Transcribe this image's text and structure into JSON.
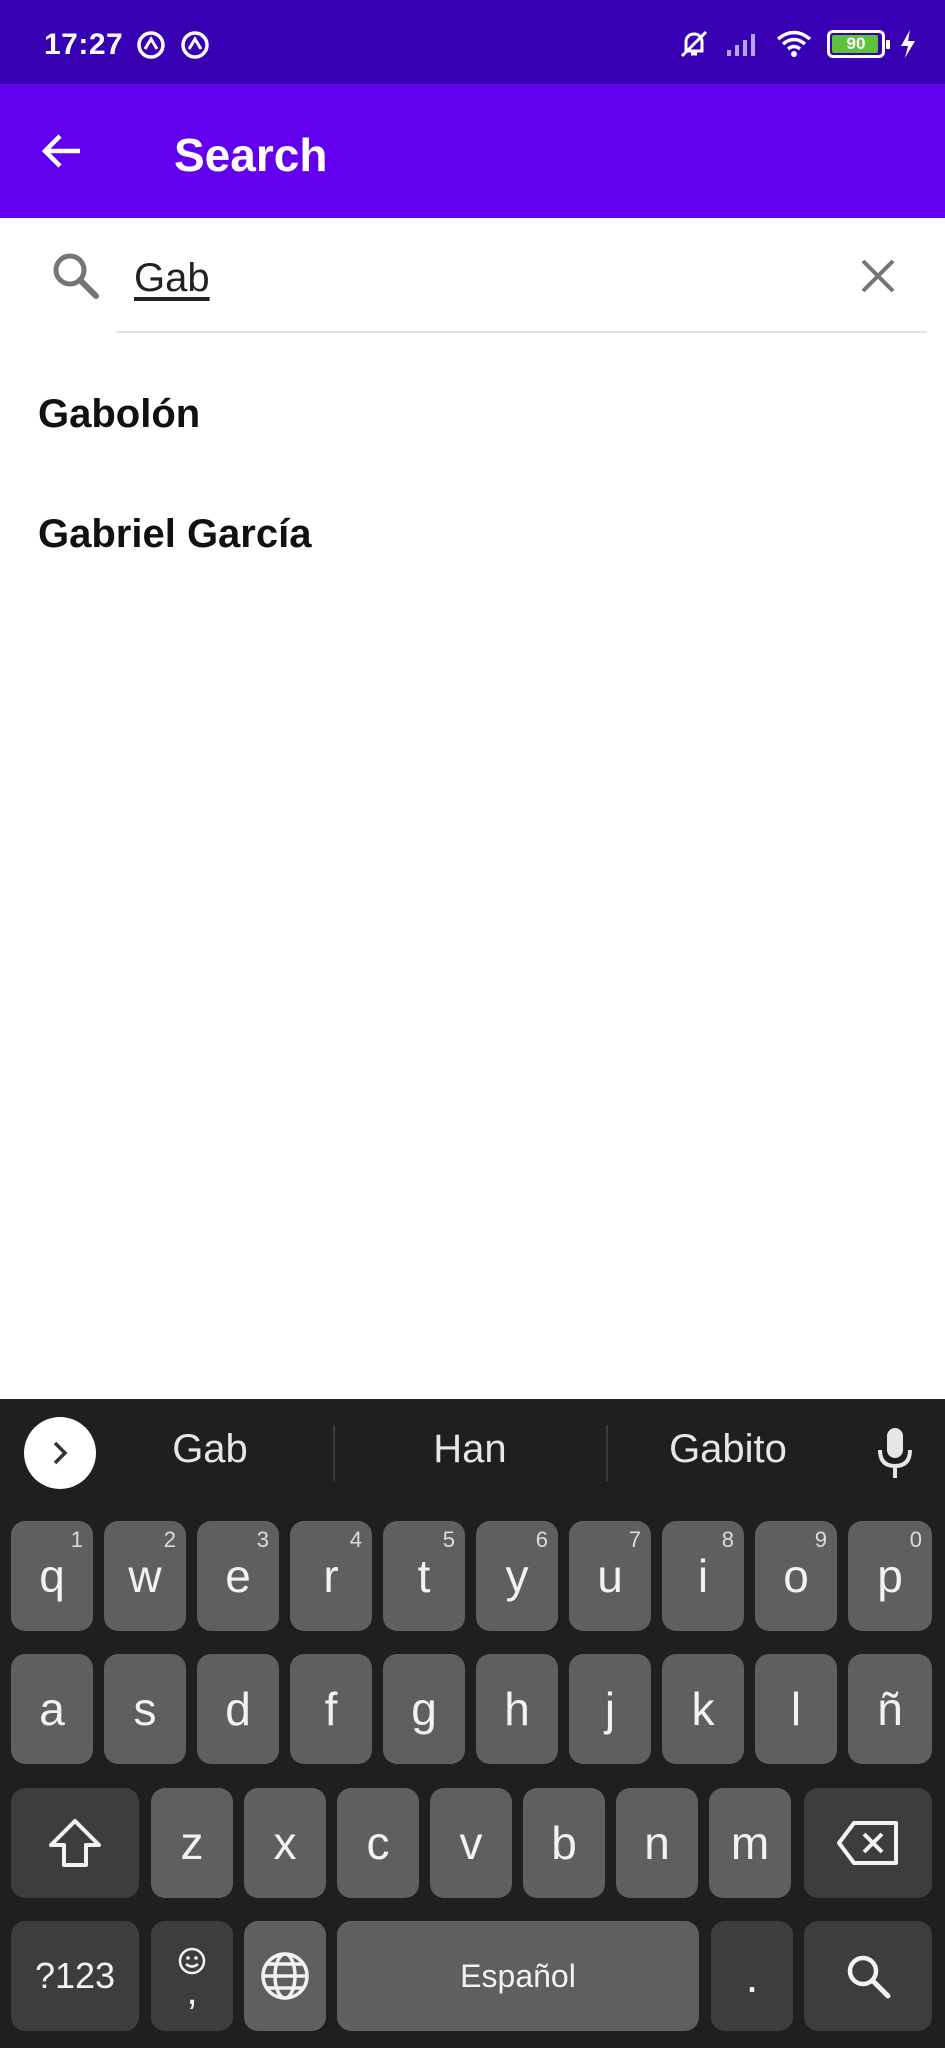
{
  "status_bar": {
    "time": "17:27",
    "battery_level": "90"
  },
  "app_bar": {
    "title": "Search"
  },
  "search": {
    "value": "Gab"
  },
  "results": [
    {
      "label": "Gabolón"
    },
    {
      "label": "Gabriel García"
    }
  ],
  "keyboard": {
    "suggestions": [
      "Gab",
      "Han",
      "Gabito"
    ],
    "rows": [
      [
        {
          "label": "q",
          "hint": "1"
        },
        {
          "label": "w",
          "hint": "2"
        },
        {
          "label": "e",
          "hint": "3"
        },
        {
          "label": "r",
          "hint": "4"
        },
        {
          "label": "t",
          "hint": "5"
        },
        {
          "label": "y",
          "hint": "6"
        },
        {
          "label": "u",
          "hint": "7"
        },
        {
          "label": "i",
          "hint": "8"
        },
        {
          "label": "o",
          "hint": "9"
        },
        {
          "label": "p",
          "hint": "0"
        }
      ],
      [
        {
          "label": "a"
        },
        {
          "label": "s"
        },
        {
          "label": "d"
        },
        {
          "label": "f"
        },
        {
          "label": "g"
        },
        {
          "label": "h"
        },
        {
          "label": "j"
        },
        {
          "label": "k"
        },
        {
          "label": "l"
        },
        {
          "label": "ñ"
        }
      ],
      [
        {
          "label": "z"
        },
        {
          "label": "x"
        },
        {
          "label": "c"
        },
        {
          "label": "v"
        },
        {
          "label": "b"
        },
        {
          "label": "n"
        },
        {
          "label": "m"
        }
      ]
    ],
    "symbols_label": "?123",
    "comma_label": ",",
    "space_label": "Español",
    "period_label": "."
  },
  "colors": {
    "status_bar": "#3700b3",
    "app_bar": "#6200ee",
    "keyboard_bg": "#1f1f1f",
    "key_bg": "#5f5f5f",
    "key_dark_bg": "#3d3d3d"
  },
  "icons": {
    "back": "arrow-left-icon",
    "search": "magnifier-icon",
    "clear": "close-icon",
    "expand": "chevron-right-icon",
    "mic": "microphone-icon",
    "shift": "shift-arrow-icon",
    "backspace": "backspace-icon",
    "globe": "globe-icon",
    "emoji": "smiley-icon",
    "search_action": "magnifier-icon"
  }
}
